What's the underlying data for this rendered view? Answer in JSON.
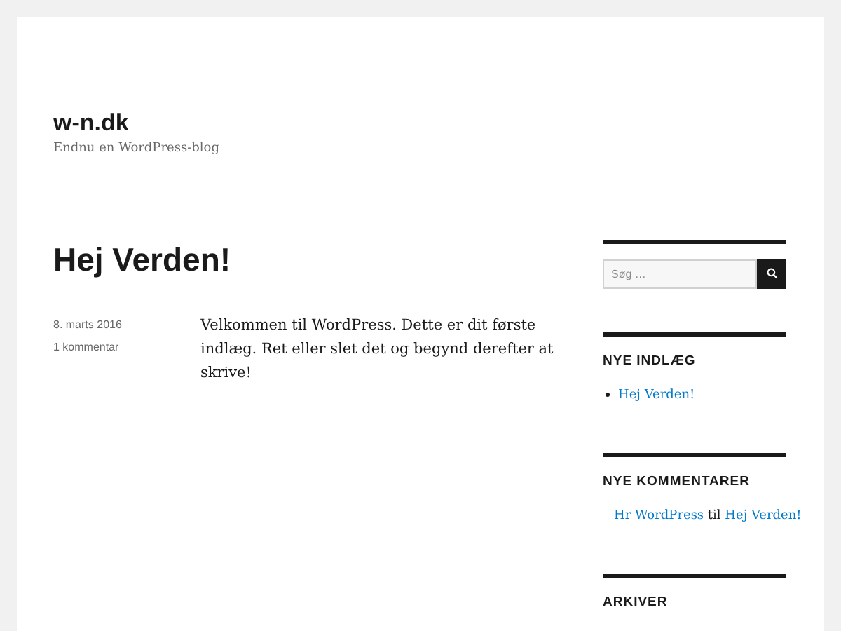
{
  "site": {
    "title": "w-n.dk",
    "tagline": "Endnu en WordPress-blog"
  },
  "post": {
    "title": "Hej Verden!",
    "date": "8. marts 2016",
    "comments": "1 kommentar",
    "body": "Velkommen til WordPress. Dette er dit første indlæg. Ret eller slet det og begynd derefter at skrive!"
  },
  "sidebar": {
    "search": {
      "placeholder": "Søg …"
    },
    "recent_posts": {
      "heading": "NYE INDLÆG",
      "items": [
        "Hej Verden!"
      ]
    },
    "recent_comments": {
      "heading": "NYE KOMMENTARER",
      "items": [
        {
          "author": "Hr WordPress",
          "joiner": "til",
          "post": "Hej Verden!"
        }
      ]
    },
    "archives": {
      "heading": "ARKIVER"
    }
  }
}
